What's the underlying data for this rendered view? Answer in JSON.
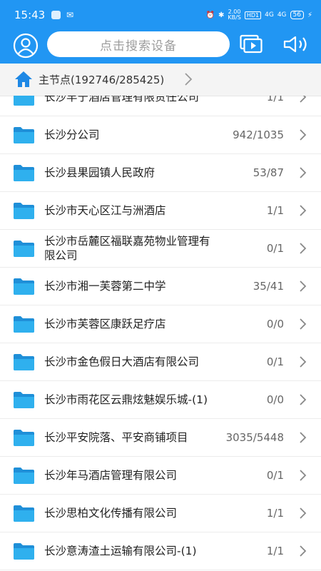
{
  "status_bar": {
    "time": "15:43",
    "speed_value": "2.00",
    "speed_unit": "KB/S",
    "hd": "HD1",
    "signal1": "4G",
    "signal2": "4G",
    "battery": "56"
  },
  "search": {
    "placeholder": "点击搜索设备"
  },
  "breadcrumb": {
    "label": "主节点(192746/285425)"
  },
  "colors": {
    "primary": "#2196f3",
    "folder": "#29a9ec"
  },
  "icons": {
    "user": "user-icon",
    "screen": "video-screen-icon",
    "volume": "speaker-icon",
    "home": "home-icon",
    "folder": "folder-icon",
    "chevron": "chevron-right-icon"
  },
  "items": [
    {
      "name": "长沙丰宁酒店管理有限责任公司",
      "count": "1/1"
    },
    {
      "name": "长沙分公司",
      "count": "942/1035"
    },
    {
      "name": "长沙县果园镇人民政府",
      "count": "53/87"
    },
    {
      "name": "长沙市天心区江与洲酒店",
      "count": "1/1"
    },
    {
      "name": "长沙市岳麓区福联嘉苑物业管理有限公司",
      "count": "0/1"
    },
    {
      "name": "长沙市湘一芙蓉第二中学",
      "count": "35/41"
    },
    {
      "name": "长沙市芙蓉区康跃足疗店",
      "count": "0/0"
    },
    {
      "name": "长沙市金色假日大酒店有限公司",
      "count": "0/1"
    },
    {
      "name": "长沙市雨花区云鼎炫魅娱乐城-(1)",
      "count": "0/0"
    },
    {
      "name": "长沙平安院落、平安商铺项目",
      "count": "3035/5448"
    },
    {
      "name": "长沙年马酒店管理有限公司",
      "count": "0/1"
    },
    {
      "name": "长沙思柏文化传播有限公司",
      "count": "1/1"
    },
    {
      "name": "长沙意涛渣土运输有限公司-(1)",
      "count": "1/1"
    }
  ]
}
